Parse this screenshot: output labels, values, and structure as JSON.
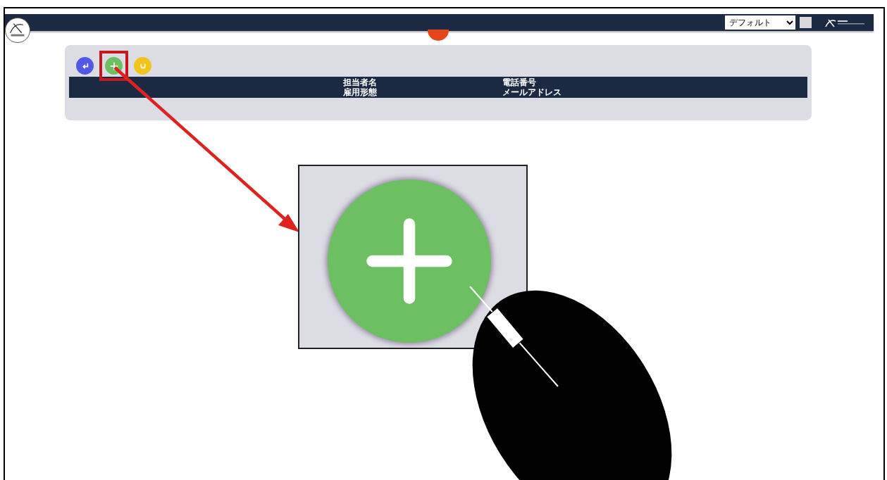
{
  "header": {
    "theme_select": {
      "value": "デフォルト"
    }
  },
  "toolbar": [
    {
      "kind": "back",
      "color": "#5158e6",
      "highlighted": false
    },
    {
      "kind": "add",
      "color": "#6cc061",
      "highlighted": true
    },
    {
      "kind": "undo",
      "color": "#f2c318",
      "highlighted": false
    }
  ],
  "table": {
    "columns": [
      {
        "line_1": "担当者名",
        "line_2": "雇用形態"
      },
      {
        "line_1": "電話番号",
        "line_2": "メールアドレス"
      }
    ]
  }
}
